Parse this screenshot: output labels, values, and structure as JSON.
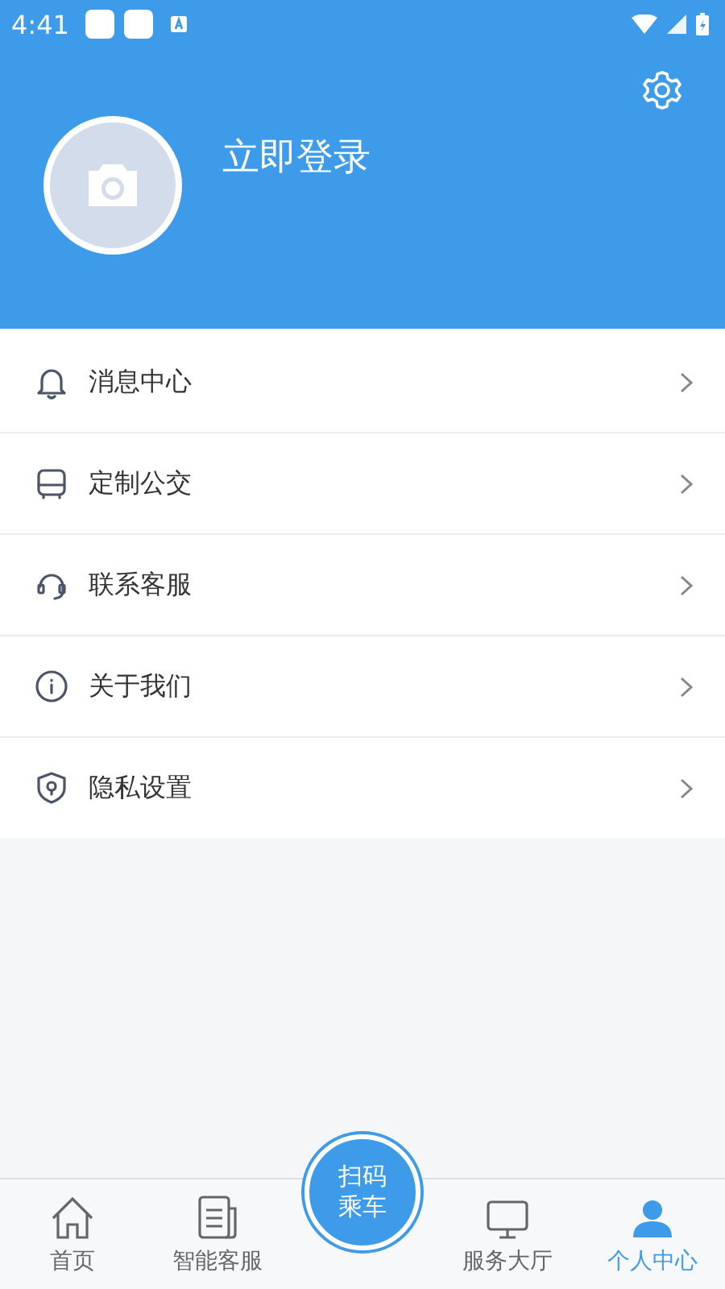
{
  "status_bar": {
    "time": "4:41"
  },
  "profile": {
    "login_label": "立即登录"
  },
  "menu": [
    {
      "kind": "bell",
      "label": "消息中心"
    },
    {
      "kind": "bus",
      "label": "定制公交"
    },
    {
      "kind": "headset",
      "label": "联系客服"
    },
    {
      "kind": "info",
      "label": "关于我们"
    },
    {
      "kind": "shield",
      "label": "隐私设置"
    }
  ],
  "scan_button": {
    "label_1": "扫码",
    "label_2": "乘车"
  },
  "tabs": [
    {
      "kind": "home",
      "label": "首页",
      "selected": false
    },
    {
      "kind": "doc",
      "label": "智能客服",
      "selected": false
    },
    {
      "kind": "hall",
      "label": "服务大厅",
      "selected": false
    },
    {
      "kind": "user",
      "label": "个人中心",
      "selected": true
    }
  ]
}
